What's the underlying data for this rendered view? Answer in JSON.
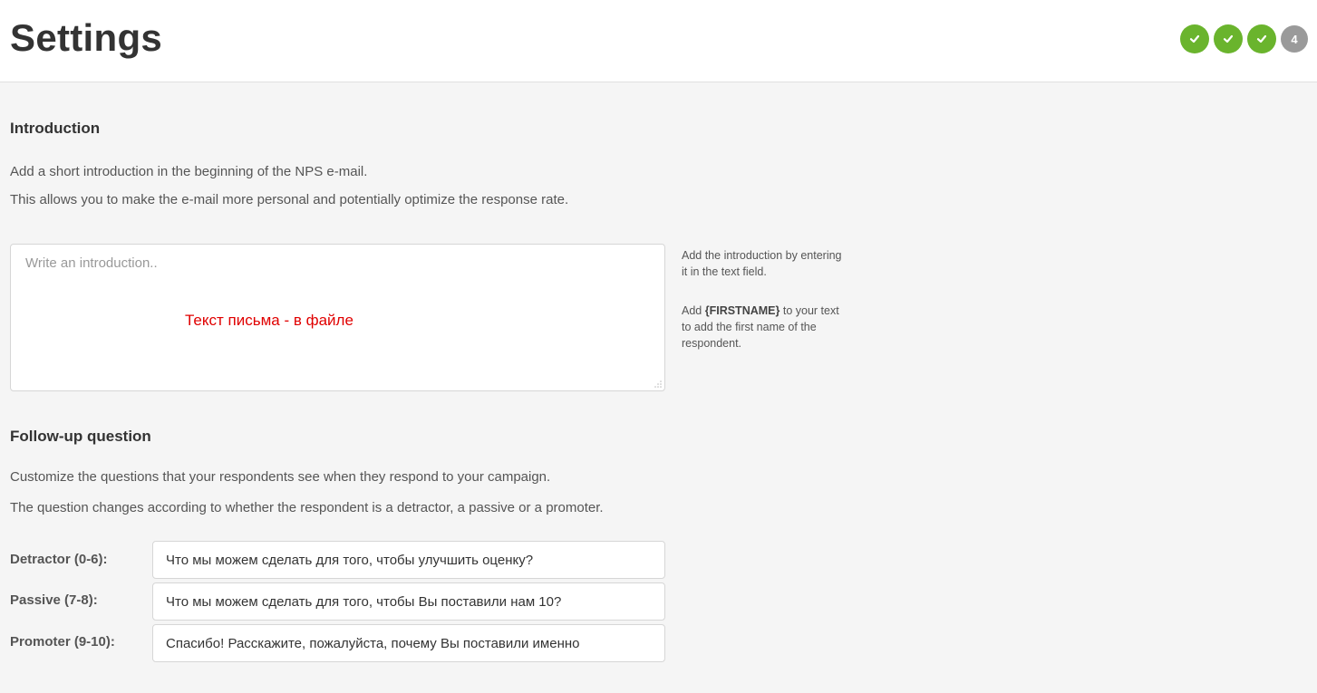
{
  "header": {
    "title": "Settings",
    "steps": [
      {
        "state": "done",
        "icon": "check-icon"
      },
      {
        "state": "done",
        "icon": "check-icon"
      },
      {
        "state": "done",
        "icon": "check-icon"
      },
      {
        "state": "pending",
        "label": "4"
      }
    ]
  },
  "introduction": {
    "title": "Introduction",
    "desc_line1": "Add a short introduction in the beginning of the NPS e-mail.",
    "desc_line2": "This allows you to make the e-mail more personal and potentially optimize the response rate.",
    "placeholder": "Write an introduction..",
    "overlay_text": "Текст письма - в файле",
    "hint_line1": "Add the introduction by entering",
    "hint_line2": "it in the text field.",
    "hint_firstname_prefix": "Add ",
    "hint_firstname_token": "{FIRSTNAME}",
    "hint_firstname_suffix": " to your text",
    "hint_line4": "to add the first name of the",
    "hint_line5": "respondent."
  },
  "followup": {
    "title": "Follow-up question",
    "desc_line1": "Customize the questions that your respondents see when they respond to your campaign.",
    "desc_line2": "The question changes according to whether the respondent is a detractor, a passive or a promoter.",
    "rows": [
      {
        "label": "Detractor (0-6):",
        "value": "Что мы можем сделать для того, чтобы улучшить оценку?"
      },
      {
        "label": "Passive (7-8):",
        "value": "Что мы можем сделать для того, чтобы Вы поставили нам 10?"
      },
      {
        "label": "Promoter (9-10):",
        "value": "Спасибо! Расскажите, пожалуйста, почему Вы поставили именно"
      }
    ]
  },
  "colors": {
    "step_done": "#6ab42d",
    "step_pending": "#9a9a9a",
    "overlay_text": "#e00000"
  }
}
